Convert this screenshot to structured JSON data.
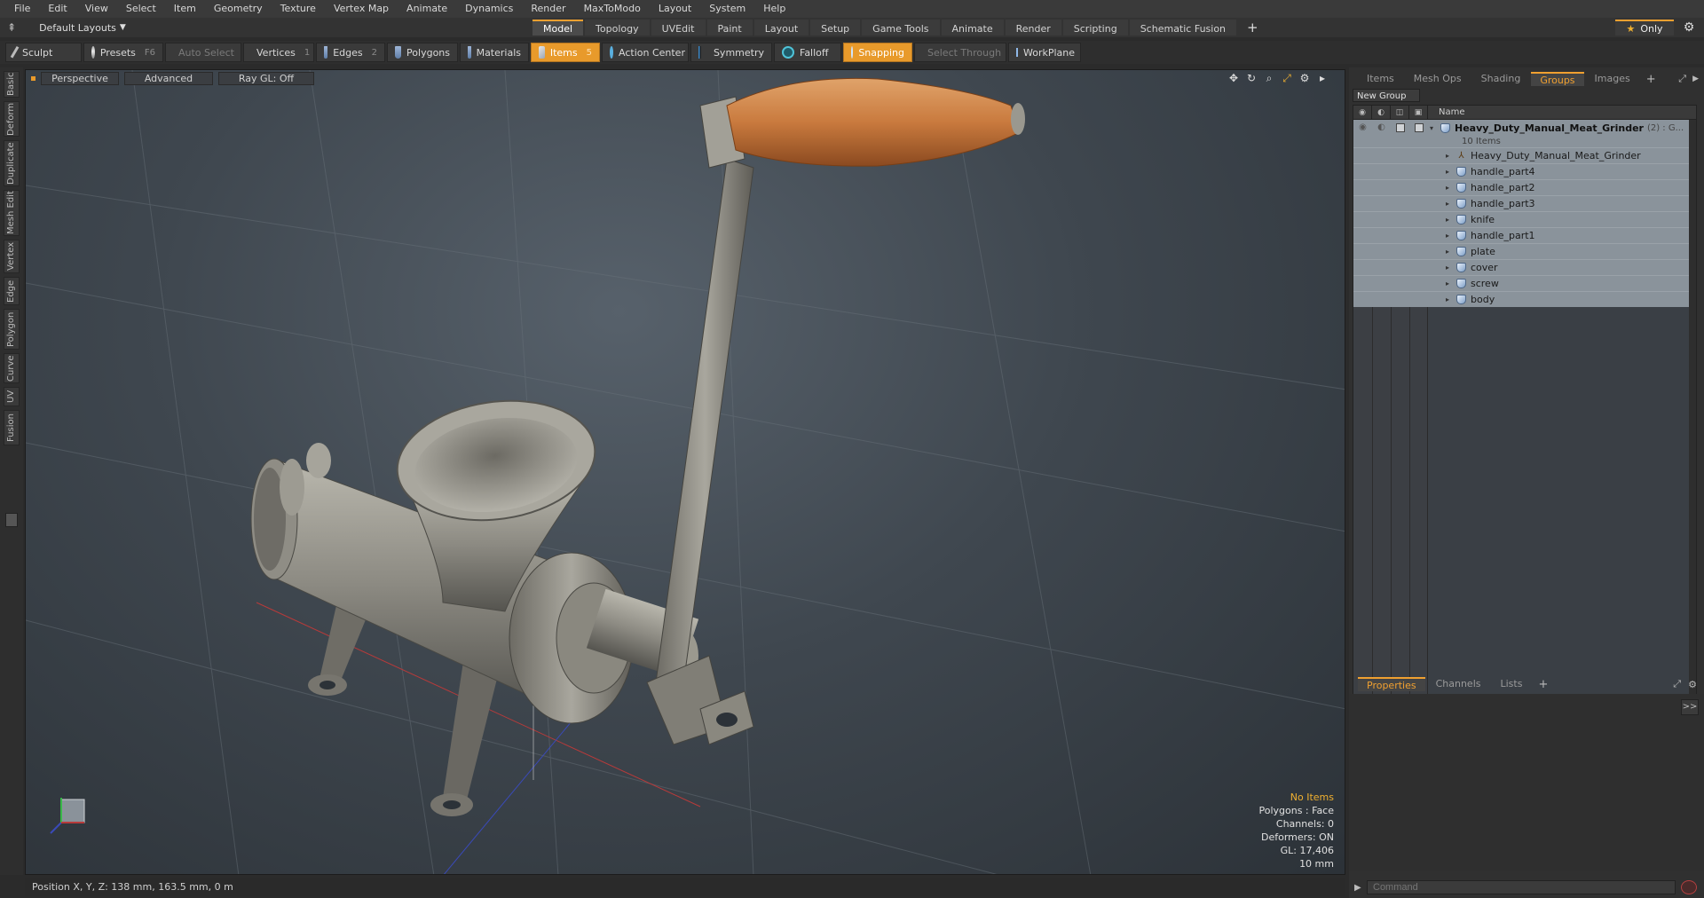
{
  "menubar": {
    "items": [
      "File",
      "Edit",
      "View",
      "Select",
      "Item",
      "Geometry",
      "Texture",
      "Vertex Map",
      "Animate",
      "Dynamics",
      "Render",
      "MaxToModo",
      "Layout",
      "System",
      "Help"
    ]
  },
  "layout_bar": {
    "layout_label": "Default Layouts",
    "tabs": [
      "Model",
      "Topology",
      "UVEdit",
      "Paint",
      "Layout",
      "Setup",
      "Game Tools",
      "Animate",
      "Render",
      "Scripting",
      "Schematic Fusion"
    ],
    "active_tab": "Model",
    "only_label": "Only"
  },
  "toolbar": {
    "sculpt": "Sculpt",
    "presets": "Presets",
    "presets_hotkey": "F6",
    "auto_select": "Auto Select",
    "vertices": "Vertices",
    "vertices_hotkey": "1",
    "edges": "Edges",
    "edges_hotkey": "2",
    "polygons": "Polygons",
    "materials": "Materials",
    "items": "Items",
    "items_hotkey": "5",
    "action_center": "Action Center",
    "symmetry": "Symmetry",
    "falloff": "Falloff",
    "snapping": "Snapping",
    "select_through": "Select Through",
    "workplane": "WorkPlane"
  },
  "left_strip": {
    "tabs": [
      "Basic",
      "Deform",
      "Duplicate",
      "Mesh Edit",
      "Vertex",
      "Edge",
      "Polygon",
      "Curve",
      "UV",
      "Fusion"
    ]
  },
  "viewport": {
    "view_mode": "Perspective",
    "shading": "Advanced",
    "raygl": "Ray GL: Off",
    "stats": {
      "no_items": "No Items",
      "polygons": "Polygons : Face",
      "channels": "Channels: 0",
      "deformers": "Deformers: ON",
      "gl": "GL: 17,406",
      "scale": "10 mm"
    }
  },
  "statusbar": {
    "position": "Position X, Y, Z:   138 mm, 163.5 mm, 0 m"
  },
  "right_panel": {
    "tabs": [
      "Items",
      "Mesh Ops",
      "Shading",
      "Groups",
      "Images"
    ],
    "active_tab": "Groups",
    "new_group": "New Group",
    "name_header": "Name",
    "root": {
      "name": "Heavy_Duty_Manual_Meat_Grinder",
      "suffix": "(2) : G...",
      "count": "10 Items"
    },
    "children": [
      {
        "name": "Heavy_Duty_Manual_Meat_Grinder",
        "type": "locator"
      },
      {
        "name": "handle_part4",
        "type": "mesh"
      },
      {
        "name": "handle_part2",
        "type": "mesh"
      },
      {
        "name": "handle_part3",
        "type": "mesh"
      },
      {
        "name": "knife",
        "type": "mesh"
      },
      {
        "name": "handle_part1",
        "type": "mesh"
      },
      {
        "name": "plate",
        "type": "mesh"
      },
      {
        "name": "cover",
        "type": "mesh"
      },
      {
        "name": "screw",
        "type": "mesh"
      },
      {
        "name": "body",
        "type": "mesh"
      }
    ],
    "bottom_tabs": [
      "Properties",
      "Channels",
      "Lists"
    ],
    "bottom_active": "Properties",
    "command_placeholder": "Command"
  },
  "colors": {
    "accent": "#f0a030",
    "snapping_active": "#e89a2b",
    "tree_row": "#8a939b"
  }
}
